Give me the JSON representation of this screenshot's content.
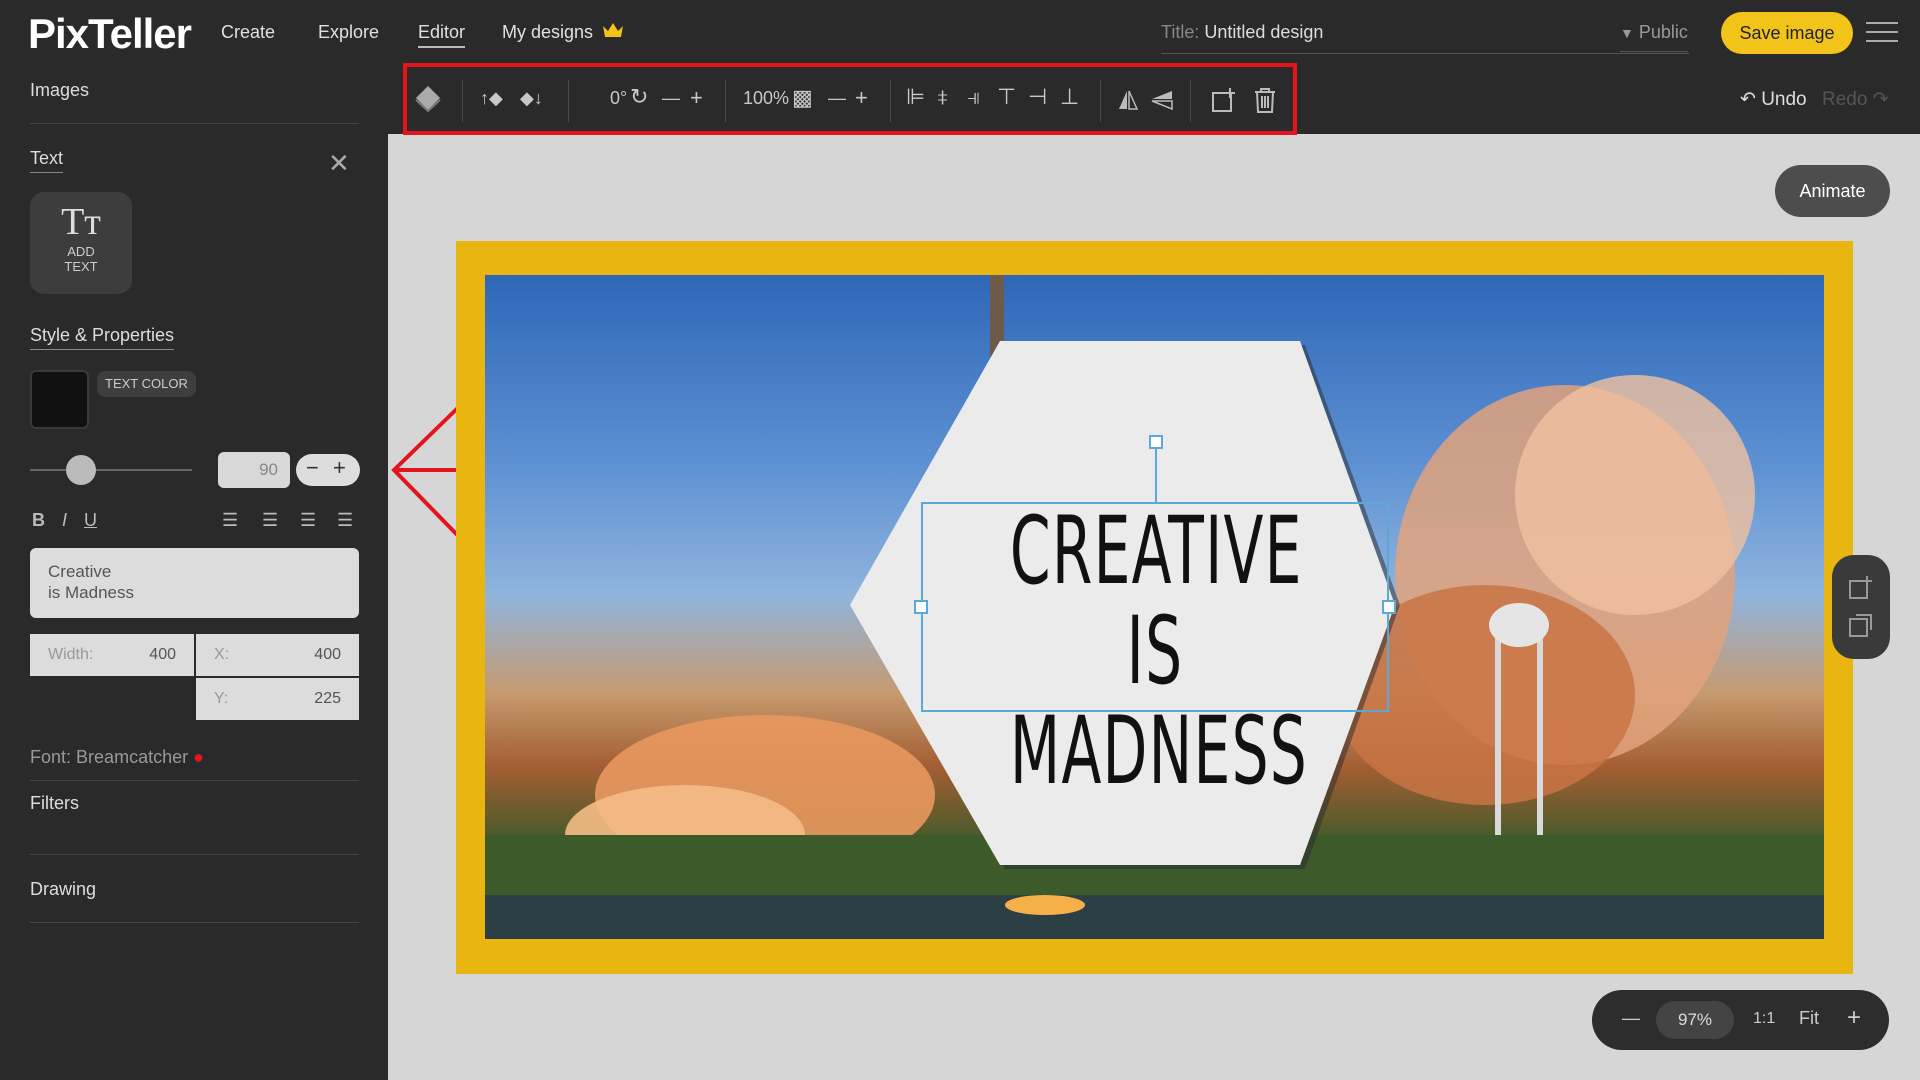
{
  "app": {
    "logo": "PixTeller",
    "nav": [
      "Create",
      "Explore",
      "Editor",
      "My designs"
    ],
    "title_label": "Title:",
    "title_value": "Untitled design",
    "visibility": "Public",
    "save_label": "Save image"
  },
  "toolbar": {
    "rotation": "0°",
    "opacity": "100%",
    "undo": "Undo",
    "redo": "Redo"
  },
  "sidebar": {
    "images": "Images",
    "text": "Text",
    "add_text_line1": "ADD",
    "add_text_line2": "TEXT",
    "style_properties": "Style & Properties",
    "text_color": "TEXT COLOR",
    "font_size": "90",
    "text_line1": "Creative",
    "text_line2": "is Madness",
    "width_label": "Width:",
    "width_value": "400",
    "x_label": "X:",
    "x_value": "400",
    "y_label": "Y:",
    "y_value": "225",
    "font_label": "Font:",
    "font_name": "Breamcatcher",
    "filters": "Filters",
    "drawing": "Drawing"
  },
  "canvas": {
    "animate": "Animate",
    "headline_line1": "CREATIVE",
    "headline_line2": "IS MADNESS",
    "frame_color": "#e9b511"
  },
  "zoom": {
    "value": "97%",
    "ratio": "1:1",
    "fit": "Fit"
  },
  "colors": {
    "accent": "#f2c318",
    "highlight": "#e3141e",
    "text_color": "#111111"
  }
}
